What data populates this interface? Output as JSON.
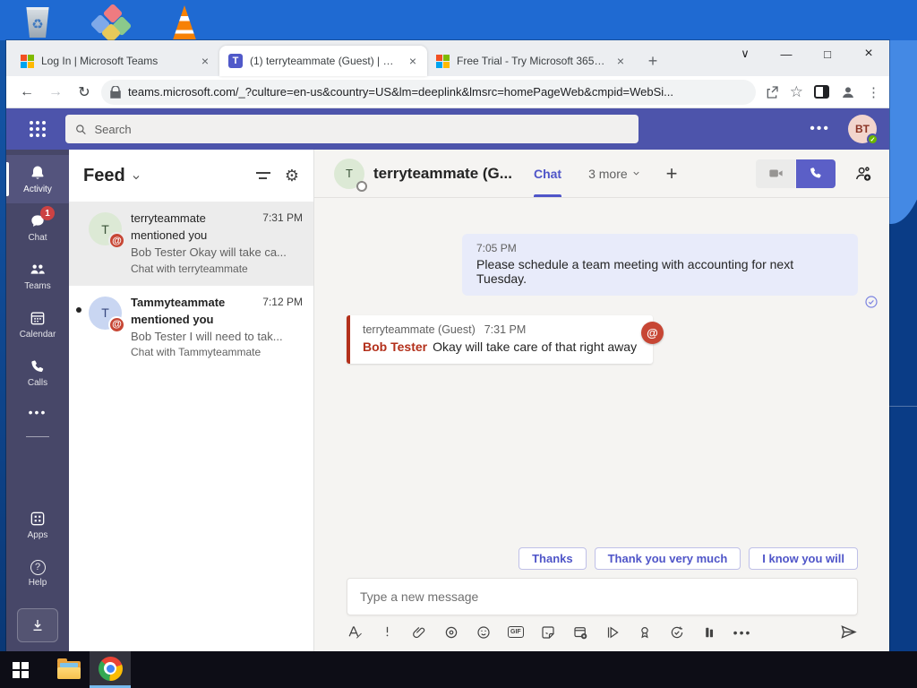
{
  "colors": {
    "teams_topbar": "#4d54ab",
    "teams_rail": "#474768",
    "teams_accent": "#5b5fc7",
    "mention_red": "#b3301b",
    "badge_red": "#c74634",
    "sent_bubble": "#e8ebfa",
    "desktop_blue": "#1f6ad2"
  },
  "browser": {
    "tabs": [
      {
        "title": "Log In | Microsoft Teams"
      },
      {
        "title": "(1) terryteammate (Guest) | Micro"
      },
      {
        "title": "Free Trial - Try Microsoft 365 for"
      }
    ],
    "url": "teams.microsoft.com/_?culture=en-us&country=US&lm=deeplink&lmsrc=homePageWeb&cmpid=WebSi..."
  },
  "teams": {
    "topbar": {
      "search_placeholder": "Search",
      "avatar_initials": "BT"
    },
    "rail": {
      "items": [
        {
          "label": "Activity"
        },
        {
          "label": "Chat",
          "badge": "1"
        },
        {
          "label": "Teams"
        },
        {
          "label": "Calendar"
        },
        {
          "label": "Calls"
        },
        {
          "label": "Apps"
        },
        {
          "label": "Help"
        }
      ]
    },
    "feed": {
      "title": "Feed",
      "items": [
        {
          "initial": "T",
          "name": "terryteammate",
          "action": "mentioned you",
          "time": "7:31 PM",
          "preview": "Bob Tester Okay will take ca...",
          "footer": "Chat with terryteammate"
        },
        {
          "initial": "T",
          "name": "Tammyteammate",
          "action": "mentioned you",
          "time": "7:12 PM",
          "preview": "Bob Tester I will need to tak...",
          "footer": "Chat with Tammyteammate"
        }
      ]
    },
    "chat": {
      "avatar_initial": "T",
      "title": "terryteammate (G...",
      "tab_label": "Chat",
      "more_label": "3 more",
      "messages": {
        "sent": {
          "time": "7:05 PM",
          "text": "Please schedule a team meeting with accounting for next Tuesday."
        },
        "mention": {
          "sender": "terryteammate (Guest)",
          "time": "7:31 PM",
          "author": "Bob Tester",
          "text": "Okay will take care of that right away"
        }
      },
      "replies": [
        "Thanks",
        "Thank you very much",
        "I know you will"
      ],
      "compose_placeholder": "Type a new message",
      "gif_label": "GIF"
    }
  }
}
